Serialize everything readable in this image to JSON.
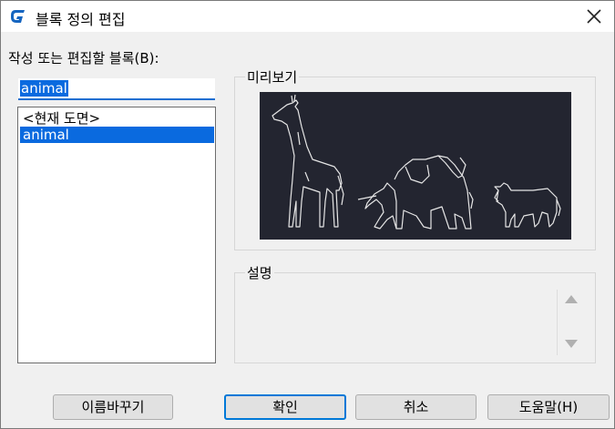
{
  "window": {
    "title": "블록 정의 편집"
  },
  "blocks": {
    "label": "작성 또는 편집할 블록(B):",
    "name_value": "animal",
    "items": [
      {
        "label": "<현재 도면>",
        "selected": false
      },
      {
        "label": "animal",
        "selected": true
      }
    ]
  },
  "preview": {
    "label": "미리보기",
    "background": "#232530",
    "line_color": "#e6e6e6"
  },
  "description": {
    "label": "설명",
    "value": ""
  },
  "buttons": {
    "rename": "이름바꾸기",
    "ok": "확인",
    "cancel": "취소",
    "help": "도움말(H)"
  },
  "colors": {
    "accent": "#0a6adf",
    "app_icon": "#1565c0"
  }
}
